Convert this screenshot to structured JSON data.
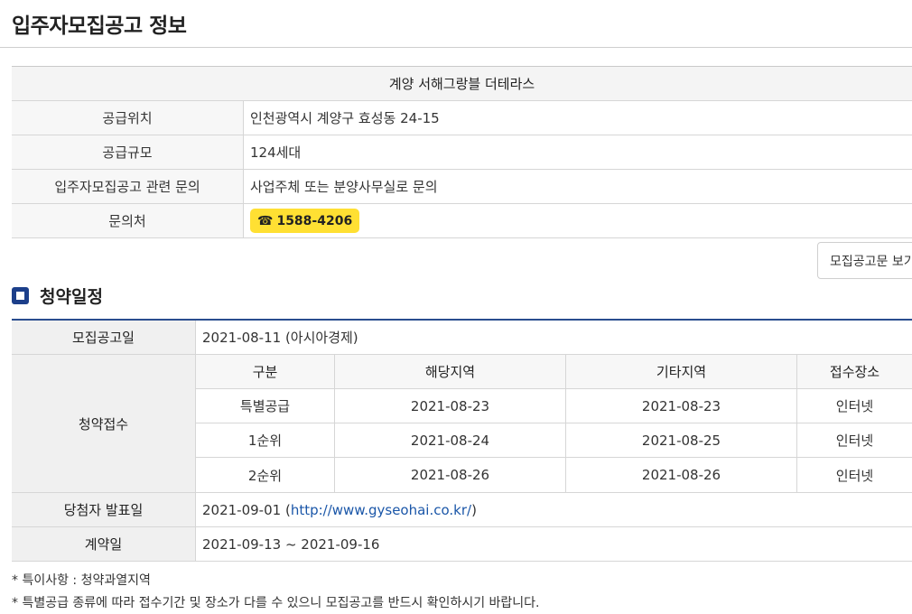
{
  "page": {
    "title": "입주자모집공고 정보"
  },
  "info": {
    "complex_name": "계양 서해그랑블 더테라스",
    "rows": [
      {
        "label": "공급위치",
        "value": "인천광역시 계양구 효성동 24-15"
      },
      {
        "label": "공급규모",
        "value": "124세대"
      },
      {
        "label": "입주자모집공고 관련 문의",
        "value": "사업주체 또는 분양사무실로 문의"
      }
    ],
    "contact": {
      "label": "문의처",
      "phone": "1588-4206",
      "phone_icon": "☎"
    }
  },
  "buttons": {
    "view_notice": "모집공고문 보기"
  },
  "schedule": {
    "section_title": "청약일정",
    "notice_date": {
      "label": "모집공고일",
      "value": "2021-08-11 (아시아경제)"
    },
    "application": {
      "label": "청약접수",
      "headers": [
        "구분",
        "해당지역",
        "기타지역",
        "접수장소"
      ],
      "rows": [
        [
          "특별공급",
          "2021-08-23",
          "2021-08-23",
          "인터넷"
        ],
        [
          "1순위",
          "2021-08-24",
          "2021-08-25",
          "인터넷"
        ],
        [
          "2순위",
          "2021-08-26",
          "2021-08-26",
          "인터넷"
        ]
      ]
    },
    "announcement": {
      "label": "당첨자 발표일",
      "date": "2021-09-01",
      "open": "( ",
      "url": "http://www.gyseohai.co.kr/",
      "close": " )"
    },
    "contract": {
      "label": "계약일",
      "value": "2021-09-13 ~ 2021-09-16"
    }
  },
  "notes": [
    "* 특이사항 : 청약과열지역",
    "* 특별공급 종류에 따라 접수기간 및 장소가 다를 수 있으니 모집공고를 반드시 확인하시기 바랍니다."
  ],
  "colors": {
    "accent": "#1c3f8a",
    "phone_bg": "#ffe033",
    "link": "#1a56a8"
  }
}
